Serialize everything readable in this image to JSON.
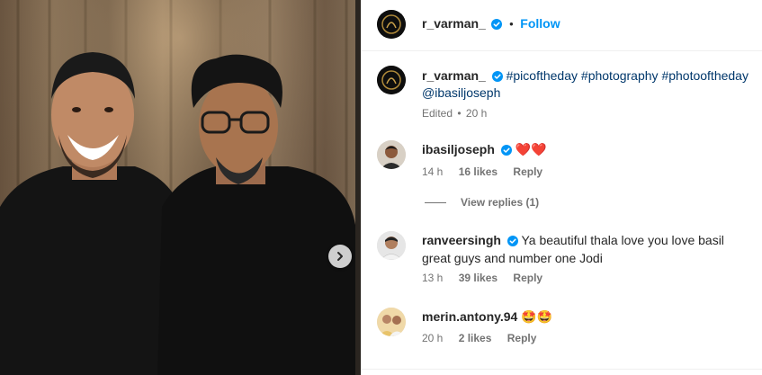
{
  "post": {
    "author": "r_varman_",
    "follow_label": "Follow",
    "separator": "•",
    "caption_tags": [
      "#picoftheday",
      "#photography",
      "#photooftheday"
    ],
    "caption_mention": "@ibasiljoseph",
    "edited": "Edited",
    "time": "20 h"
  },
  "comments": [
    {
      "user": "ibasiljoseph",
      "text": "❤️❤️",
      "time": "14 h",
      "likes": "16 likes",
      "reply": "Reply",
      "view_replies": "View replies (1)"
    },
    {
      "user": "ranveersingh",
      "text": "Ya beautiful thala love you love basil great guys and number one Jodi",
      "time": "13 h",
      "likes": "39 likes",
      "reply": "Reply"
    },
    {
      "user": "merin.antony.94",
      "text": "🤩🤩",
      "time": "20 h",
      "likes": "2 likes",
      "reply": "Reply"
    }
  ],
  "colors": {
    "link": "#0095f6",
    "hashtag": "#00376b",
    "meta": "#737373"
  }
}
